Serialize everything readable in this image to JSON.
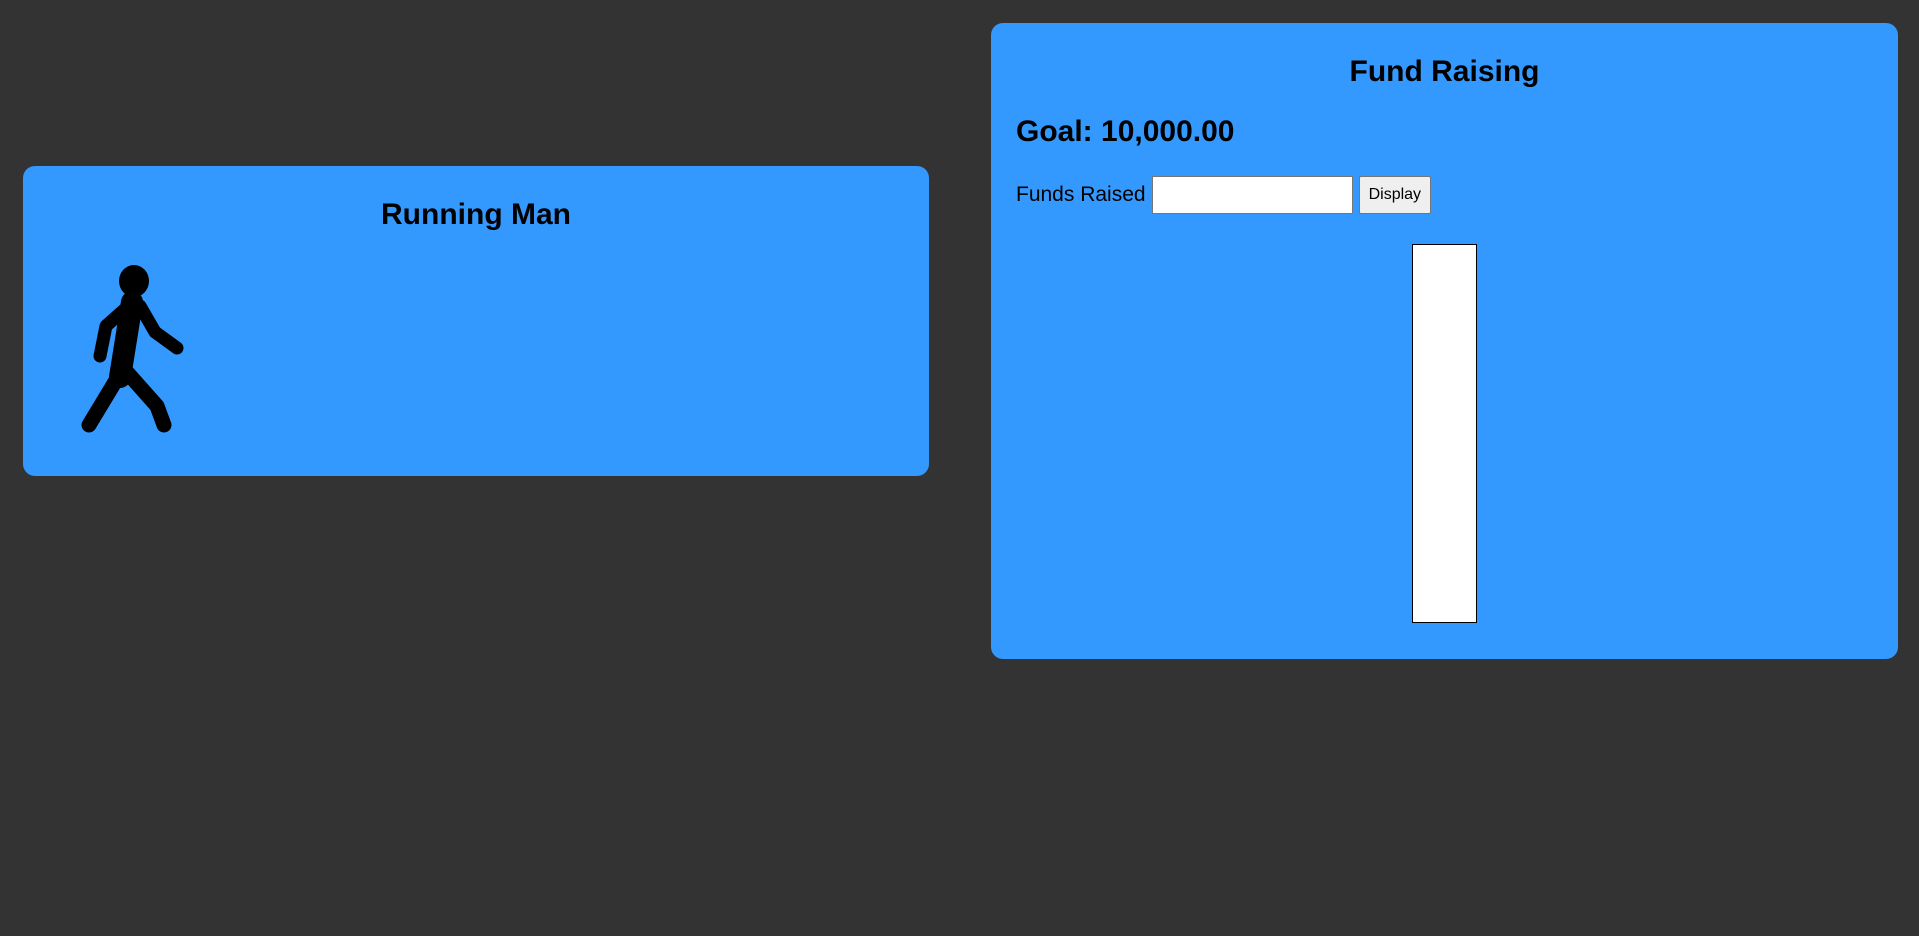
{
  "colors": {
    "page_background": "#333333",
    "panel_background": "#3399ff",
    "thermometer_background": "#ffffff",
    "thermometer_fill": "#ff3333"
  },
  "running_man": {
    "title": "Running Man",
    "icon": "walking-person-icon"
  },
  "fund_raising": {
    "title": "Fund Raising",
    "goal_text": "Goal: 10,000.00",
    "funds_label": "Funds Raised",
    "funds_input": {
      "value": "",
      "placeholder": ""
    },
    "display_label": "Display",
    "raised_fraction": 0
  }
}
